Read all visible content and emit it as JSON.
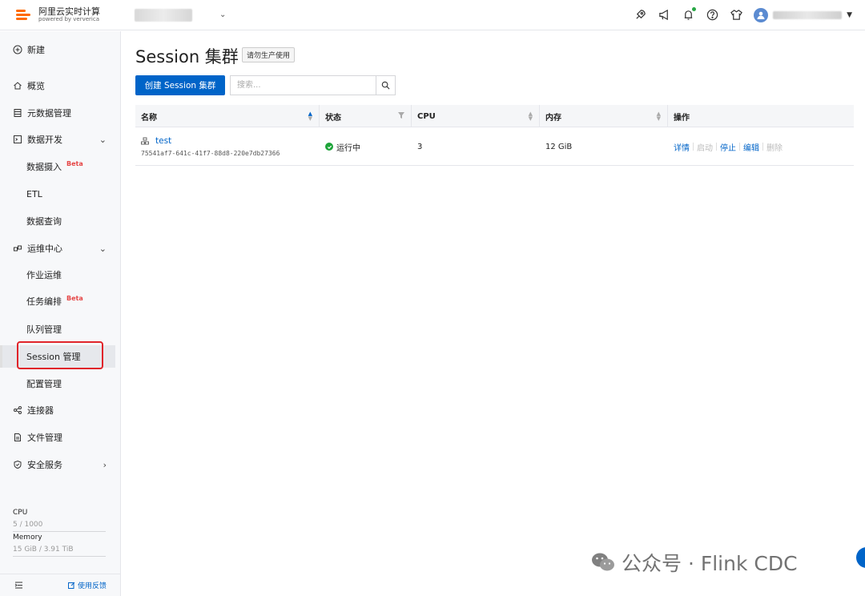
{
  "header": {
    "brand_title": "阿里云实时计算",
    "brand_sub": "powered by ververica",
    "icons": [
      "rocket-icon",
      "megaphone-icon",
      "bell-icon",
      "help-icon",
      "shirt-icon"
    ]
  },
  "sidebar": {
    "new_label": "新建",
    "items": [
      {
        "label": "概览",
        "icon": "home-icon"
      },
      {
        "label": "元数据管理",
        "icon": "database-icon"
      },
      {
        "label": "数据开发",
        "icon": "terminal-icon",
        "expanded": true
      },
      {
        "label": "数据摄入",
        "badge": "Beta"
      },
      {
        "label": "ETL"
      },
      {
        "label": "数据查询"
      },
      {
        "label": "运维中心",
        "icon": "ops-icon",
        "expanded": true
      },
      {
        "label": "作业运维"
      },
      {
        "label": "任务编排",
        "badge": "Beta"
      },
      {
        "label": "队列管理"
      },
      {
        "label": "Session 管理",
        "active": true
      },
      {
        "label": "配置管理"
      },
      {
        "label": "连接器",
        "icon": "share-icon"
      },
      {
        "label": "文件管理",
        "icon": "file-icon"
      },
      {
        "label": "安全服务",
        "icon": "shield-icon"
      }
    ],
    "resources": {
      "cpu_label": "CPU",
      "cpu_value": "5 / 1000",
      "memory_label": "Memory",
      "memory_value": "15 GiB / 3.91 TiB"
    },
    "feedback_label": "使用反馈"
  },
  "main": {
    "title": "Session 集群",
    "tag": "请勿生产使用",
    "create_button": "创建 Session 集群",
    "search_placeholder": "搜索...",
    "columns": [
      "名称",
      "状态",
      "CPU",
      "内存",
      "操作"
    ],
    "rows": [
      {
        "name": "test",
        "id": "75541af7-641c-41f7-88d8-220e7db27366",
        "status": "运行中",
        "cpu": "3",
        "memory": "12 GiB",
        "actions": [
          {
            "label": "详情",
            "enabled": true
          },
          {
            "label": "启动",
            "enabled": false
          },
          {
            "label": "停止",
            "enabled": true
          },
          {
            "label": "编辑",
            "enabled": true
          },
          {
            "label": "删除",
            "enabled": false
          }
        ]
      }
    ]
  },
  "watermark": "公众号 · Flink CDC",
  "colors": {
    "primary": "#0064c8",
    "brand": "#ff6a00",
    "running": "#1ea43a",
    "highlight": "#e0242a"
  }
}
